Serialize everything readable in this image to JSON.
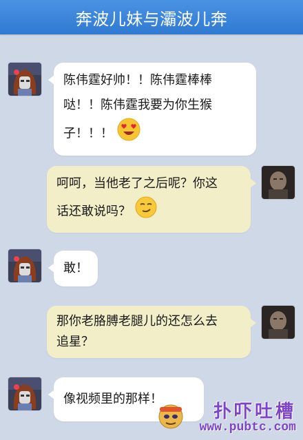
{
  "header": {
    "title": "奔波儿妹与灞波儿奔"
  },
  "messages": [
    {
      "side": "left",
      "lines": [
        "陈伟霆好帅！！陈伟霆棒棒",
        "哒！！陈伟霆我要为你生猴",
        "子！！！"
      ],
      "emoji": "heart-eyes-emoji"
    },
    {
      "side": "right",
      "lines": [
        "呵呵，当他老了之后呢？你这",
        "话还敢说吗？"
      ],
      "emoji": "smirk-emoji"
    },
    {
      "side": "left",
      "lines": [
        "敢！"
      ]
    },
    {
      "side": "right",
      "lines": [
        "那你老胳膊老腿儿的还怎么去",
        "追星？"
      ]
    },
    {
      "side": "left",
      "lines": [
        "像视频里的那样！"
      ]
    }
  ],
  "watermark": {
    "title": "扑吓吐槽",
    "url": "www.pubtc.com"
  },
  "colors": {
    "header": "#3b86db",
    "background": "#cfd8e7",
    "bubble_left": "#ffffff",
    "bubble_right": "#f1eec8",
    "watermark": "#7d44c7"
  }
}
